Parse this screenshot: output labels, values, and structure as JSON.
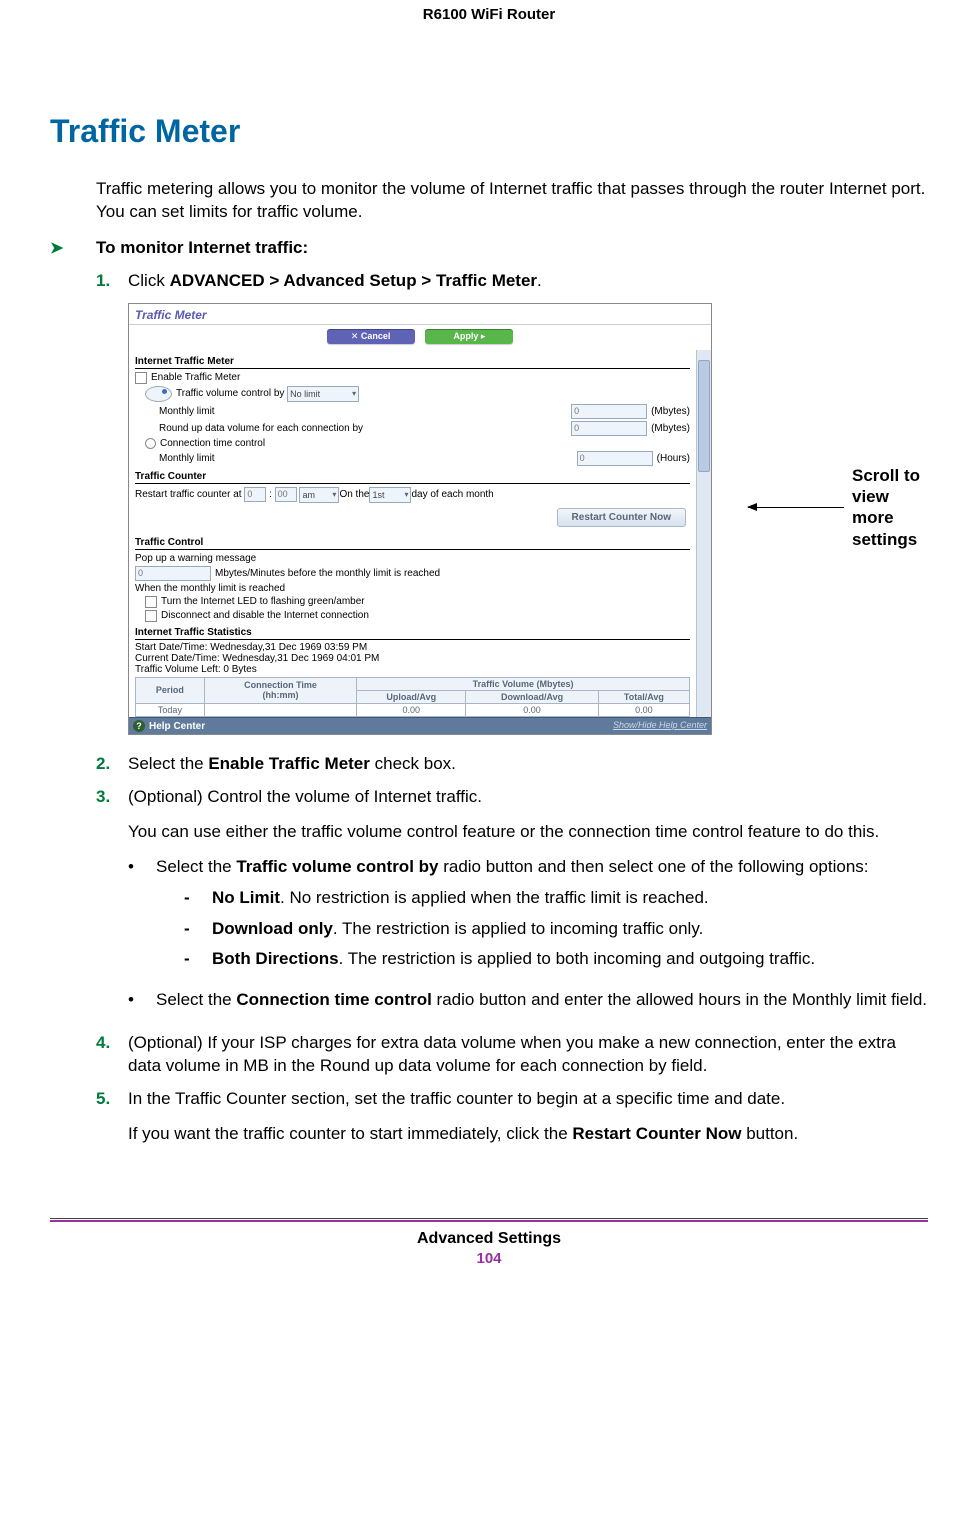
{
  "doc_header": "R6100 WiFi Router",
  "section_heading": "Traffic Meter",
  "intro": "Traffic metering allows you to monitor the volume of Internet traffic that passes through the router Internet port. You can set limits for traffic volume.",
  "procedure_label": "To monitor Internet traffic:",
  "callout": "Scroll to view<br>more settings",
  "steps": {
    "s1_pre": "Click ",
    "s1_bold": "ADVANCED > Advanced Setup > Traffic Meter",
    "s1_post": ".",
    "s2_pre": "Select the ",
    "s2_bold": "Enable Traffic Meter",
    "s2_post": " check box.",
    "s3": "(Optional) Control the volume of Internet traffic.",
    "s3_p2": "You can use either the traffic volume control feature or the connection time control feature to do this.",
    "s3_b1_pre": "Select the ",
    "s3_b1_bold": "Traffic volume control by",
    "s3_b1_post": " radio button and then select one of the following options:",
    "d1_bold": "No Limit",
    "d1_rest": ". No restriction is applied when the traffic limit is reached.",
    "d2_bold": "Download only",
    "d2_rest": ". The restriction is applied to incoming traffic only.",
    "d3_bold": "Both Directions",
    "d3_rest": ". The restriction is applied to both incoming and outgoing traffic.",
    "s3_b2_pre": "Select the ",
    "s3_b2_bold": "Connection time control",
    "s3_b2_post": " radio button and enter the allowed hours in the Monthly limit field.",
    "s4": "(Optional) If your ISP charges for extra data volume when you make a new connection, enter the extra data volume in MB in the Round up data volume for each connection by field.",
    "s5": "In the Traffic Counter section, set the traffic counter to begin at a specific time and date.",
    "s5_p2_pre": "If you want the traffic counter to start immediately, click the ",
    "s5_p2_bold": "Restart Counter Now",
    "s5_p2_post": " button."
  },
  "shot": {
    "title": "Traffic Meter",
    "btn_cancel": "Cancel",
    "btn_apply": "Apply",
    "sec1": "Internet Traffic Meter",
    "enable": "Enable Traffic Meter",
    "volctl": "Traffic volume control by",
    "volctl_sel": "No limit",
    "monthly_limit": "Monthly limit",
    "roundup": "Round up data volume for each connection by",
    "conntime": "Connection time control",
    "mbytes": "(Mbytes)",
    "hours": "(Hours)",
    "val0": "0",
    "sec2": "Traffic Counter",
    "restart_at": "Restart traffic counter at",
    "hh": "0",
    "mm": "00",
    "ampm": "am",
    "onthe": " On the ",
    "day1": "1st",
    "dayrest": " day of each month",
    "btn_restart": "Restart Counter Now",
    "sec3": "Traffic Control",
    "popup": "Pop up a warning message",
    "before": "Mbytes/Minutes before the monthly limit is reached",
    "when": "When the monthly limit is reached",
    "led": "Turn the Internet LED to flashing green/amber",
    "disc": "Disconnect and disable the Internet connection",
    "sec4": "Internet Traffic Statistics",
    "startdt": "Start Date/Time: Wednesday,31 Dec 1969 03:59 PM",
    "curdt": "Current Date/Time: Wednesday,31 Dec 1969 04:01 PM",
    "volleft": "Traffic Volume Left: 0 Bytes",
    "th_period": "Period",
    "th_conn": "Connection Time\n(hh:mm)",
    "th_vol": "Traffic Volume (Mbytes)",
    "th_up": "Upload/Avg",
    "th_dn": "Download/Avg",
    "th_tot": "Total/Avg",
    "row_today": "Today",
    "row_val": "0.00",
    "help": "Help Center",
    "help_link": "Show/Hide Help Center"
  },
  "footer_label": "Advanced Settings",
  "footer_page": "104"
}
